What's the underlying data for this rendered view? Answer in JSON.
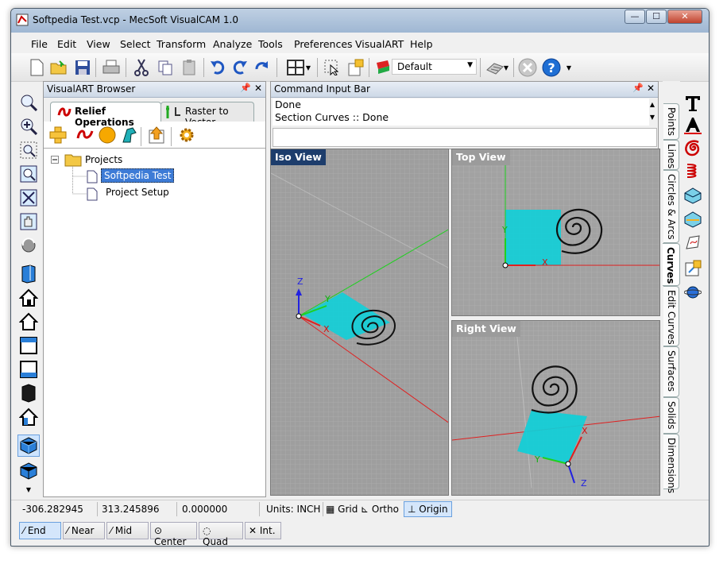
{
  "window": {
    "title": "Softpedia Test.vcp - MecSoft VisualCAM 1.0",
    "min_label": "—",
    "max_label": "☐",
    "close_label": "✕"
  },
  "menu": [
    "File",
    "Edit",
    "View",
    "Select",
    "Transform",
    "Analyze",
    "Tools",
    "Preferences",
    "VisualART",
    "Help"
  ],
  "toolbar": {
    "material_combo_value": "Default"
  },
  "browser": {
    "title": "VisualART Browser",
    "tabs": [
      "Relief Operations",
      "Raster to Vector"
    ],
    "tree": {
      "root": "Projects",
      "children": [
        "Softpedia Test",
        "Project Setup"
      ]
    }
  },
  "command_bar": {
    "title": "Command Input Bar",
    "lines": [
      "Done",
      "Section Curves :: Done"
    ]
  },
  "views": {
    "iso": "Iso View",
    "top": "Top View",
    "right": "Right View"
  },
  "axes": {
    "x": "X",
    "y": "Y",
    "z": "Z"
  },
  "status": {
    "x": "-306.282945",
    "y": "313.245896",
    "z": "0.000000",
    "units": "Units: INCH",
    "grid": "Grid",
    "ortho": "Ortho",
    "origin": "Origin"
  },
  "snaps": [
    "End",
    "Near",
    "Mid",
    "Center",
    "Quad",
    "Int."
  ],
  "right_tabs": [
    "Points",
    "Lines",
    "Circles & Arcs",
    "Curves",
    "Edit Curves",
    "Surfaces",
    "Solids",
    "Dimensions"
  ],
  "right_tab_active": "Curves",
  "colors": {
    "active_view_header": "#1d3d6c",
    "inactive_view_header": "#9b9b9b",
    "x_axis": "#e02020",
    "y_axis": "#20c020",
    "z_axis": "#2020e0",
    "plane": "#00c8d8"
  }
}
